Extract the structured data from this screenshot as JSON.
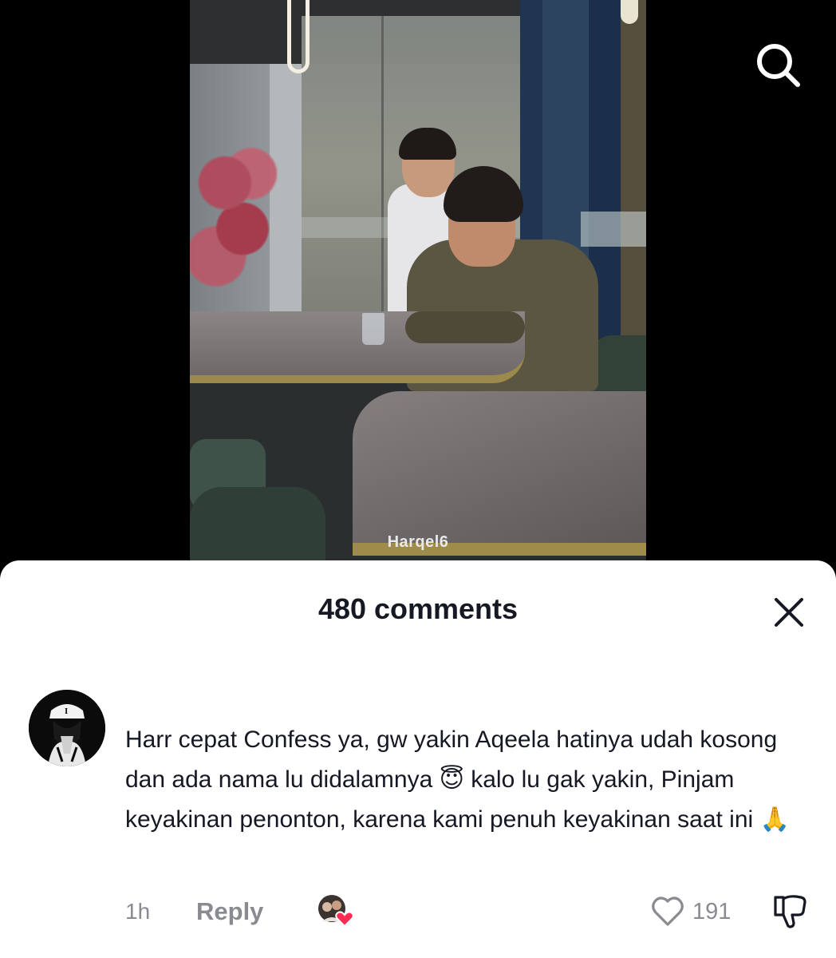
{
  "video": {
    "watermark": "Harqel6",
    "search_icon": "search-icon"
  },
  "comments_sheet": {
    "title": "480 comments",
    "close_icon": "close-icon",
    "comments": [
      {
        "text": "Harr cepat Confess ya, gw yakin Aqeela hatinya udah kosong dan ada nama lu didalamnya 😇 kalo lu gak yakin, Pinjam keyakinan penonton, karena kami penuh keyakinan saat ini 🙏",
        "time": "1h",
        "reply_label": "Reply",
        "likes": "191",
        "creator_liked": true,
        "like_icon": "heart-outline-icon",
        "dislike_icon": "thumbs-down-icon"
      }
    ]
  },
  "colors": {
    "sheet_bg": "#ffffff",
    "text_primary": "#161823",
    "text_secondary": "#8a8b91",
    "heart": "#fe2c55"
  }
}
